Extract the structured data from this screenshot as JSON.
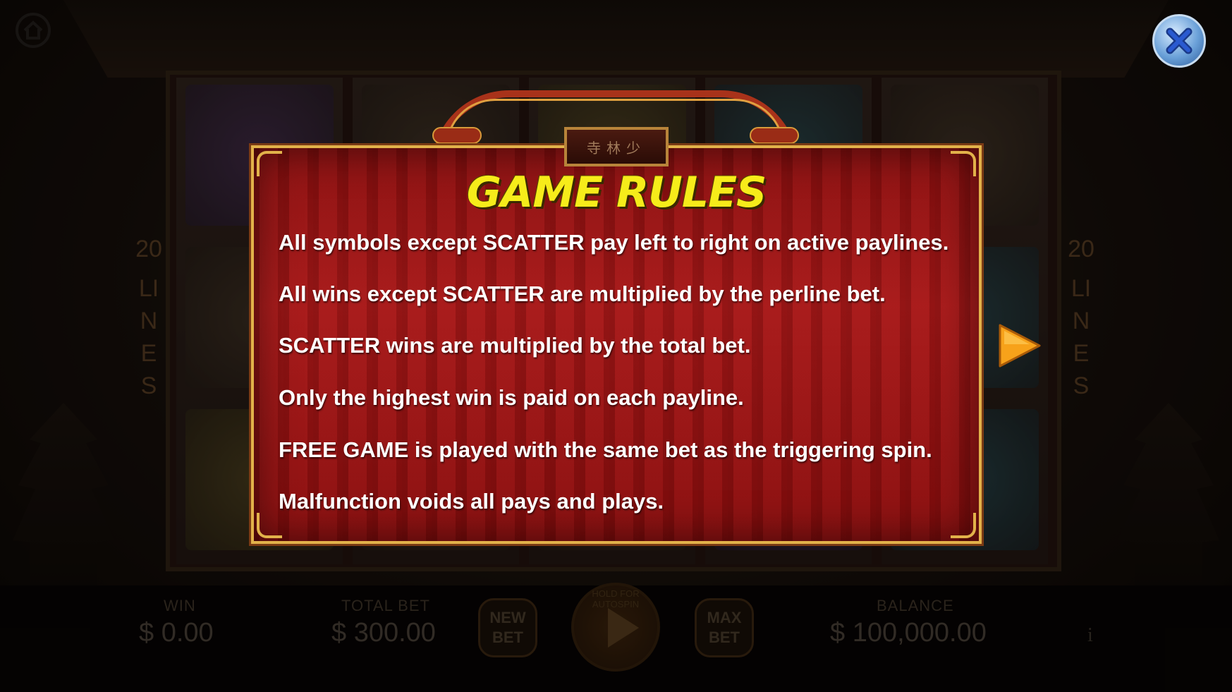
{
  "popup": {
    "title": "GAME RULES",
    "plaque_text": "寺林少",
    "rules": [
      "All symbols except SCATTER pay left to right on active paylines.",
      "All wins except SCATTER are multiplied by the perline bet.",
      "SCATTER wins are multiplied by the total bet.",
      "Only the highest win is paid on each payline.",
      "FREE GAME is played with the same bet as the triggering spin.",
      "Malfunction voids all pays and plays."
    ],
    "close_icon": "close-icon",
    "next_icon": "next-page-arrow-icon"
  },
  "game": {
    "lines_count": "20",
    "lines_label": "LINES"
  },
  "controls": {
    "win_label": "WIN",
    "win_value": "$ 0.00",
    "total_bet_label": "TOTAL BET",
    "total_bet_value": "$ 300.00",
    "new_bet_label": "NEW BET",
    "spin_hint": "HOLD FOR AUTOSPIN",
    "max_bet_label": "MAX BET",
    "balance_label": "BALANCE",
    "balance_value": "$ 100,000.00",
    "info_label": "i"
  },
  "colors": {
    "title": "#f6ec1a",
    "panel_red": "#a81818",
    "panel_border": "#e2b24a",
    "next_arrow": "#f7a21a"
  }
}
